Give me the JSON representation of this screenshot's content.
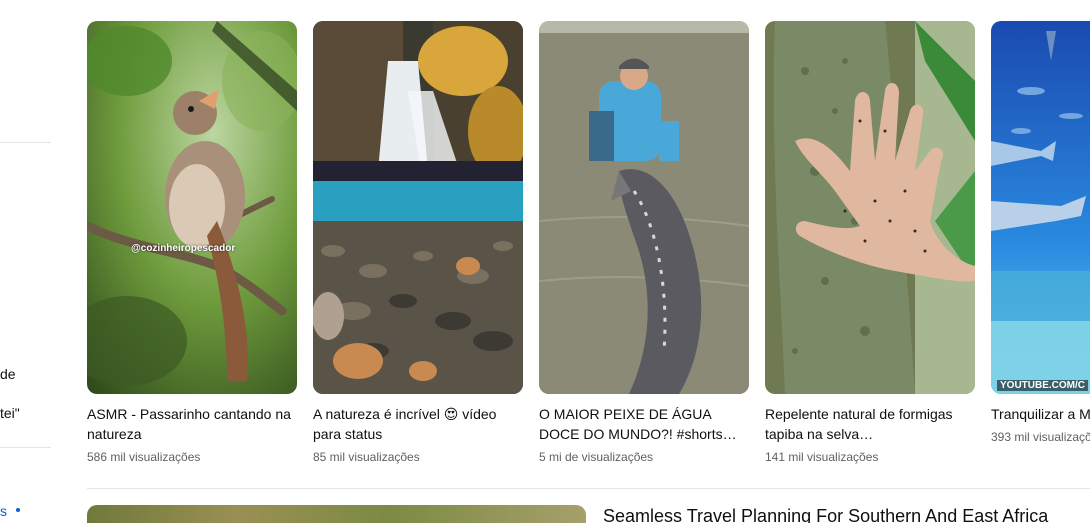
{
  "sidebar": {
    "partial_items": [
      "de",
      "tei\""
    ],
    "bottom_fragment": "s"
  },
  "shorts": [
    {
      "title": "ASMR - Passarinho cantando na natureza",
      "views": "586 mil visualizações",
      "overlay": "@cozinheiropescador"
    },
    {
      "title": "A natureza é incrível 😍 vídeo para status",
      "views": "85 mil visualizações"
    },
    {
      "title": "O MAIOR PEIXE DE ÁGUA DOCE DO MUNDO?! #shorts…",
      "views": "5 mi de visualizações"
    },
    {
      "title": "Repelente natural de formigas tapiba na selva…",
      "views": "141 mil visualizações"
    },
    {
      "title": "Tranquilizar a M",
      "views": "393 mil visualizaçõe",
      "overlay": "YOUTUBE.COM/C"
    }
  ],
  "next_video": {
    "title": "Seamless Travel Planning For Southern And East Africa"
  }
}
